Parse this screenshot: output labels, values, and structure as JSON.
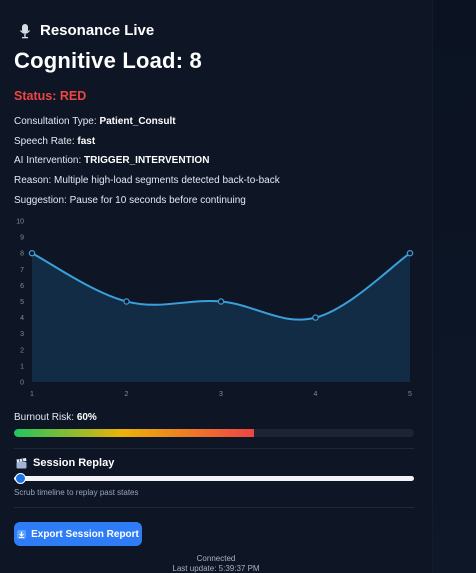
{
  "app": {
    "title": "Resonance Live"
  },
  "headline": "Cognitive Load: 8",
  "status": "Status: RED",
  "info": {
    "consultation_label": "Consultation Type: ",
    "consultation_value": "Patient_Consult",
    "speech_label": "Speech Rate: ",
    "speech_value": "fast",
    "ai_label": "AI Intervention: ",
    "ai_value": "TRIGGER_INTERVENTION",
    "reason": "Reason: Multiple high-load segments detected back-to-back",
    "suggestion": "Suggestion: Pause for 10 seconds before continuing"
  },
  "chart_data": {
    "type": "area",
    "x": [
      1,
      2,
      3,
      4,
      5
    ],
    "values": [
      8,
      5,
      5,
      4,
      8
    ],
    "ylim": [
      0,
      10
    ],
    "yticks": [
      "0",
      "1",
      "2",
      "3",
      "4",
      "5",
      "6",
      "7",
      "8",
      "9",
      "10"
    ],
    "xticks": [
      "1",
      "2",
      "3",
      "4",
      "5"
    ],
    "line_color": "#3aa0dc",
    "fill_color": "#12304a"
  },
  "burnout": {
    "label": "Burnout Risk: ",
    "value_text": "60%",
    "fraction": 0.6
  },
  "replay": {
    "title": "Session Replay",
    "hint": "Scrub timeline to replay past states",
    "position": 0.0
  },
  "export": {
    "label": "Export Session Report"
  },
  "footer": {
    "connection": "Connected",
    "last_update": "Last update: 5:39:37 PM"
  },
  "colors": {
    "status": "#ef4444",
    "accent": "#2f7df6"
  }
}
